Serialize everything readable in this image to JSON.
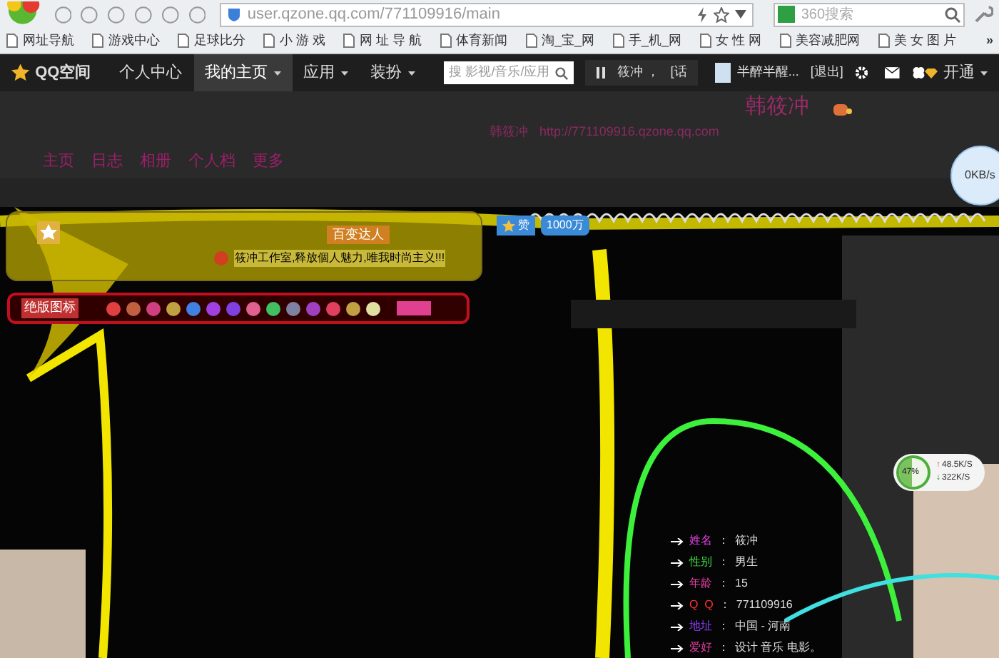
{
  "browser": {
    "url": "user.qzone.qq.com/771109916/main",
    "search_placeholder": "360搜索",
    "bookmarks": [
      "网址导航",
      "游戏中心",
      "足球比分",
      "小 游 戏",
      "网 址 导 航",
      "体育新闻",
      "淘_宝_网",
      "手_机_网",
      "女 性 网",
      "美容减肥网",
      "美 女 图 片"
    ],
    "more": "»"
  },
  "nav": {
    "logo": "QQ空间",
    "items": [
      {
        "label": "个人中心",
        "dropdown": false,
        "selected": false
      },
      {
        "label": "我的主页",
        "dropdown": true,
        "selected": true
      },
      {
        "label": "应用",
        "dropdown": true,
        "selected": false
      },
      {
        "label": "装扮",
        "dropdown": true,
        "selected": false
      }
    ],
    "search_placeholder": "搜 影视/音乐/应用",
    "music": "筱冲 ，",
    "music_extra": "[话",
    "user": "半醉半醒...",
    "logout": "[退出]",
    "vip": "开通"
  },
  "header": {
    "name": "韩筱冲",
    "owner": "韩筱冲",
    "url": "http://771109916.qzone.qq.com",
    "links": [
      "主页",
      "日志",
      "相册",
      "个人档",
      "更多"
    ]
  },
  "banner": {
    "title": "百变达人",
    "motto": "筱冲工作室,释放個人魅力,唯我时尚主义!!!",
    "like": "赞",
    "count": "1000万",
    "badge_label": "绝版图标"
  },
  "profile_separator": "：",
  "profile": [
    {
      "label": "姓名",
      "value": "筱冲",
      "color": "#e040e0"
    },
    {
      "label": "性别",
      "value": "男生",
      "color": "#40e040"
    },
    {
      "label": "年龄",
      "value": "15",
      "color": "#e040a0"
    },
    {
      "label": "Q  Q",
      "value": "771109916",
      "color": "#ff3030"
    },
    {
      "label": "地址",
      "value": "中国 - 河南",
      "color": "#9040ff"
    },
    {
      "label": "爱好",
      "value": "设计 音乐 电影。",
      "color": "#e040a0"
    }
  ],
  "speed": {
    "level": 0.47,
    "percent": "47%",
    "up_arrow": "↑",
    "up": "48.5K/S",
    "down_arrow": "↓",
    "down": "322K/S",
    "bubble": "0KB/s"
  }
}
